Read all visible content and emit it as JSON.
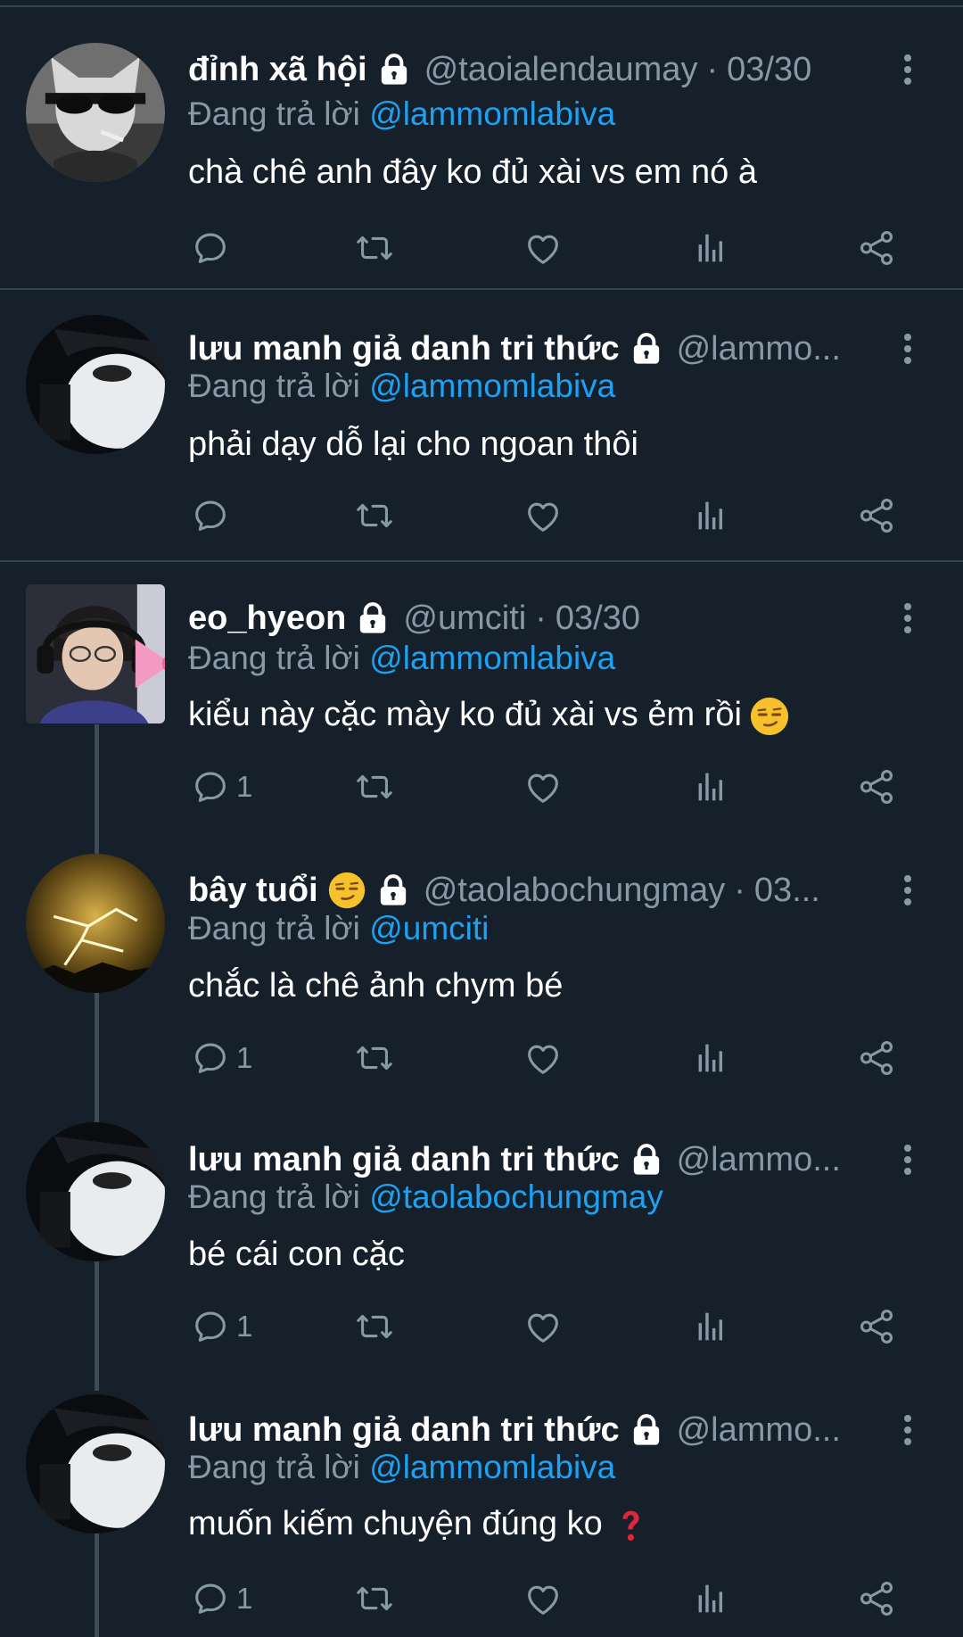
{
  "tweets": [
    {
      "name": "đỉnh xã hội",
      "handle": "@taoialendaumay",
      "separator": "·",
      "date": "03/30",
      "replying_label": "Đang trả lời",
      "replying_to": "@lammomlabiva",
      "text": "chà chê anh đây ko đủ xài vs em nó à",
      "reply_count": ""
    },
    {
      "name": "lưu manh giả danh tri thức",
      "handle": "@lammo...",
      "replying_label": "Đang trả lời",
      "replying_to": "@lammomlabiva",
      "text": "phải dạy dỗ lại cho ngoan thôi",
      "reply_count": ""
    },
    {
      "name": "eo_hyeon",
      "handle": "@umciti",
      "separator": "·",
      "date": "03/30",
      "replying_label": "Đang trả lời",
      "replying_to": "@lammomlabiva",
      "text": "kiểu này cặc mày ko đủ xài vs ẻm rồi",
      "reply_count": "1"
    },
    {
      "name": "bây tuổi",
      "handle": "@taolabochungmay",
      "separator": "·",
      "date": "03...",
      "replying_label": "Đang trả lời",
      "replying_to": "@umciti",
      "text": "chắc là chê ảnh chym bé",
      "reply_count": "1"
    },
    {
      "name": "lưu manh giả danh tri thức",
      "handle": "@lammo...",
      "replying_label": "Đang trả lời",
      "replying_to": "@taolabochungmay",
      "text": "bé cái con cặc",
      "reply_count": "1"
    },
    {
      "name": "lưu manh giả danh tri thức",
      "handle": "@lammo...",
      "replying_label": "Đang trả lời",
      "replying_to": "@lammomlabiva",
      "text": "muốn kiếm chuyện đúng ko",
      "reply_count": "1"
    }
  ],
  "icons": {
    "reply": "reply-icon",
    "retweet": "retweet-icon",
    "like": "heart-icon",
    "analytics": "analytics-icon",
    "share": "share-icon",
    "lock": "lock-icon",
    "more": "more-vertical-icon"
  },
  "colors": {
    "background": "#15202b",
    "secondary_text": "#8899a6",
    "link": "#1da1f2",
    "divider": "#38444d"
  }
}
